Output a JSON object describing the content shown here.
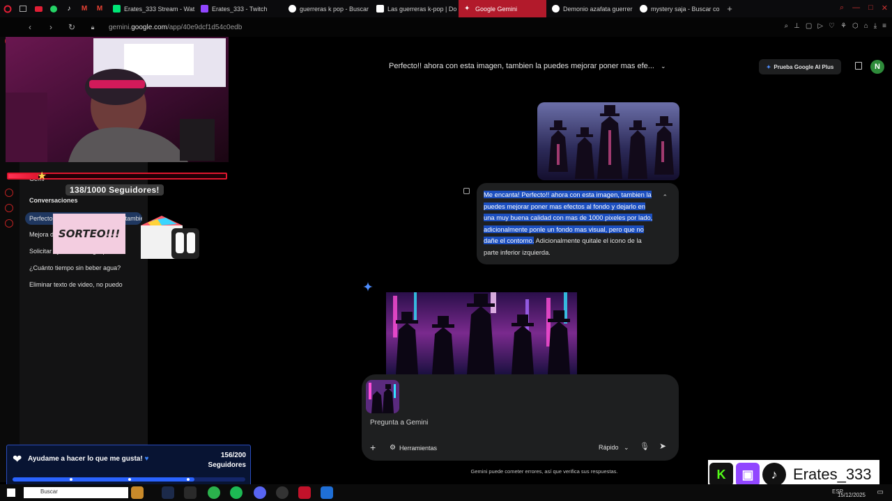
{
  "browser": {
    "tabs": [
      {
        "label": "Erates_333 Stream - Wat",
        "color": "#00e676"
      },
      {
        "label": "Erates_333 - Twitch",
        "color": "#9146ff"
      },
      {
        "label": "guerreras k pop - Buscar",
        "color": "#ffffff"
      },
      {
        "label": "Las guerreras k-pop | Do",
        "color": "#ffffff"
      },
      {
        "label": "Google Gemini",
        "color": "#4d8dff"
      },
      {
        "label": "Demonio azafata guerrer",
        "color": "#ffffff"
      },
      {
        "label": "mystery saja - Buscar co",
        "color": "#ffffff"
      }
    ],
    "active_tab_index": 4,
    "url_prefix": "gemini.",
    "url_domain": "google.com",
    "url_path": "/app/40e9dcf1d54c0edb"
  },
  "sidebar": {
    "top_label": "Gemi",
    "heading": "Conversaciones",
    "items": [
      {
        "label": "Perfecto!! ahora con esta imagen, tambien la..."
      },
      {
        "label": "Mejora de imagen de pantalla"
      },
      {
        "label": "Solicitar ayuda de Google para"
      },
      {
        "label": "¿Cuánto tiempo sin beber agua?"
      },
      {
        "label": "Eliminar texto de video, no puedo"
      }
    ]
  },
  "header": {
    "title": "Perfecto!! ahora con esta imagen, tambien la puedes mejorar poner mas efe...",
    "plus_label": "Prueba Google AI Plus",
    "avatar_letter": "N"
  },
  "chat": {
    "user_message_selected": "Me encanta! Perfecto!! ahora con esta imagen, tambien la puedes mejorar poner mas efectos al fondo y dejarlo en una muy buena calidad con mas de 1000 pixeles por lado, adicionalmente ponle un fondo mas visual, pero que no dañe el contorno.",
    "user_message_rest": " Adicionalmente quitale el icono de la parte inferior izquierda."
  },
  "prompt": {
    "placeholder": "Pregunta a Gemini",
    "tools_label": "Herramientas",
    "mode_label": "Rápido"
  },
  "disclaimer": "Gemini puede cometer errores, así que verifica sus respuestas.",
  "overlay": {
    "followers_label": "138/1000 Seguidores!",
    "followers_progress": 0.138,
    "sorteo_label": "SORTEO!!!",
    "goal_text": "Ayudame a hacer lo que me gusta!",
    "goal_count": "156/200",
    "goal_unit": "Seguidores",
    "goal_progress": 0.78,
    "social_name": "Erates_333"
  },
  "taskbar": {
    "search_label": "Buscar",
    "lang": "ESP",
    "date": "15/12/2025"
  }
}
